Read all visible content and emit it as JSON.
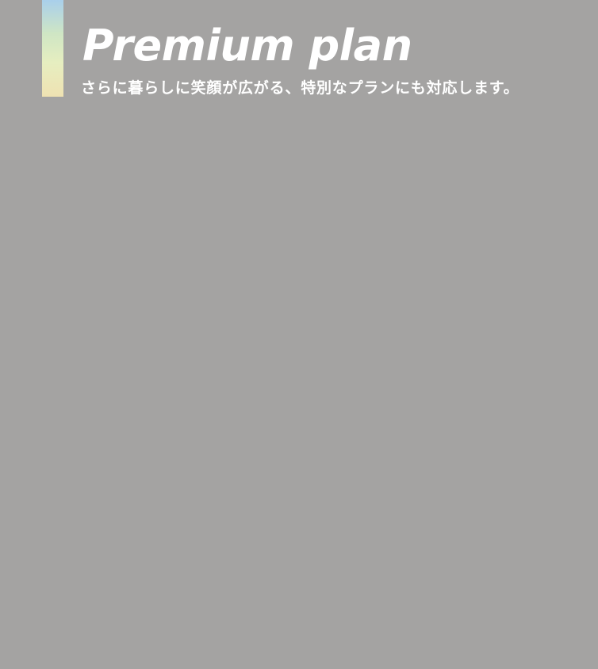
{
  "section": {
    "title": "Premium plan",
    "subtitle": "さらに暮らしに笑顔が広がる、特別なプランにも対応します。",
    "colors": {
      "background": "#a4a3a2",
      "text": "#ffffff",
      "accent_gradient": [
        "#a9cfeb",
        "#cfe6c4",
        "#e6eec0",
        "#efe2b2"
      ]
    }
  }
}
